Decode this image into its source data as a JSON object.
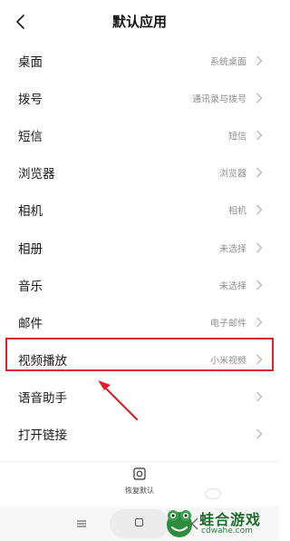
{
  "header": {
    "title": "默认应用",
    "back_icon": "chevron-left-icon"
  },
  "rows": [
    {
      "label": "桌面",
      "value": "系统桌面"
    },
    {
      "label": "拨号",
      "value": "通讯录与拨号"
    },
    {
      "label": "短信",
      "value": "短信"
    },
    {
      "label": "浏览器",
      "value": "浏览器"
    },
    {
      "label": "相机",
      "value": "相机"
    },
    {
      "label": "相册",
      "value": "未选择"
    },
    {
      "label": "音乐",
      "value": "未选择"
    },
    {
      "label": "邮件",
      "value": "电子邮件"
    },
    {
      "label": "视频播放",
      "value": "小米视频"
    },
    {
      "label": "语音助手",
      "value": ""
    },
    {
      "label": "打开链接",
      "value": ""
    }
  ],
  "annotation": {
    "highlight_color": "#d9222a",
    "highlighted_row": "视频播放"
  },
  "footer": {
    "restore_label": "恢复默认",
    "restore_icon": "restore-icon"
  },
  "nav_bar": {
    "icons": [
      "menu-icon",
      "home-icon",
      "back-icon"
    ]
  },
  "watermark": {
    "title": "蛙合游戏",
    "domain": "cdwahe.com",
    "brand_color": "#1f6b2c"
  }
}
